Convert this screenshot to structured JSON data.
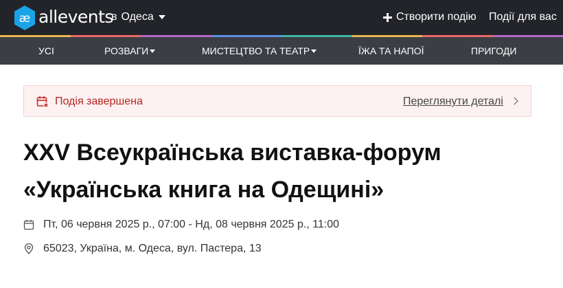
{
  "header": {
    "brand": "allevents",
    "city_prefix": "в",
    "city": "Одеса",
    "create_label": "Створити подію",
    "for_you_label": "Події для вас"
  },
  "rainbow_colors": [
    "#e8b64d",
    "#e96a6a",
    "#b766c7",
    "#5b8fe0",
    "#3fb6a8",
    "#e8b64d",
    "#e96a6a",
    "#b766c7"
  ],
  "categories": [
    {
      "label": "Усі"
    },
    {
      "label": "Розваги"
    },
    {
      "label": "Мистецтво та театр"
    },
    {
      "label": "Їжа та напої"
    },
    {
      "label": "Пригоди"
    }
  ],
  "notice": {
    "text": "Подія завершена",
    "link": "Переглянути деталі",
    "icon": "calendar-x-icon"
  },
  "event": {
    "title_line1": "XXV Всеукраїнська виставка-форум",
    "title_line2": "«Українська книга на Одещині»",
    "datetime": "Пт, 06 червня 2025 р., 07:00 - Нд, 08 червня 2025 р., 11:00",
    "address": "65023, Україна, м. Одеса, вул. Пастера, 13"
  }
}
